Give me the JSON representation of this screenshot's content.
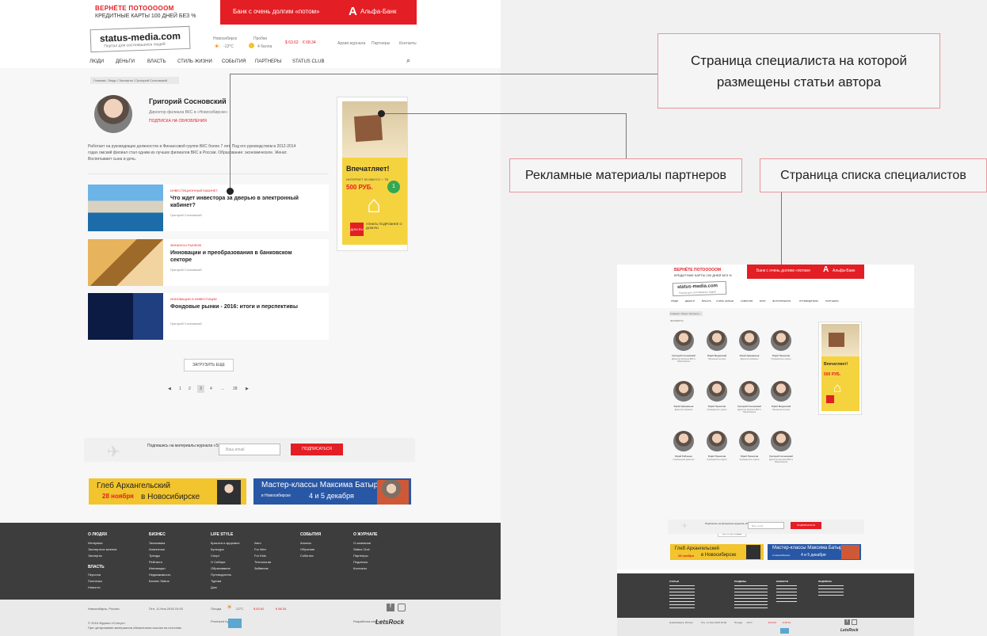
{
  "left": {
    "promo": {
      "line1": "ВЕРНЁТЕ ПОТОООООМ",
      "line2": "КРЕДИТНЫЕ КАРТЫ 100 ДНЕЙ БЕЗ %"
    },
    "bank": {
      "text": "Банк с очень долгим «потом»",
      "logo": "А",
      "name": "Альфа-Банк"
    },
    "brand": {
      "name": "status-media.com",
      "tagline": "Портал для состоявшихся людей"
    },
    "header_info": {
      "city": "Новосибирск",
      "temp": "-12°C",
      "traffic_label": "Пробки",
      "traffic": "4 балла",
      "usd": "$ 63.62",
      "eur": "€ 68.34",
      "links": [
        "Архив журнала",
        "Партнеры",
        "Контакты"
      ]
    },
    "nav": [
      "ЛЮДИ",
      "ДЕНЬГИ",
      "ВЛАСТЬ",
      "СТИЛЬ ЖИЗНИ",
      "СОБЫТИЯ",
      "ПАРТНЕРЫ",
      "STATUS CLUB"
    ],
    "breadcrumb": "Главная / Люди / Эксперты / Григорий Сосновский",
    "author": {
      "name": "Григорий Сосновский",
      "role": "Директор филиала ВКС в «Новосибирске»",
      "subscribe": "ПОДПИСКА НА ОБНОВЛЕНИЯ",
      "bio": "Работает на руководящих должностях в Финансовой группе ВКС более 7 лет. Под его руководством в 2012-2014 годах омский филиал стал одним из лучших филиалов ВКС в России. Образование: экономическое. Женат. Воспитывает сына и дочь."
    },
    "articles": [
      {
        "tag": "ИНВЕСТИЦИОННЫЙ КАБИНЕТ",
        "title": "Что ждет инвестора за дверью в электронный кабинет?",
        "author": "Григорий Сосновский"
      },
      {
        "tag": "ФИНАНСЫ РЫНКОВ",
        "title": "Инновации и преобразования в банковском секторе",
        "author": "Григорий Сосновский"
      },
      {
        "tag": "ИННОВАЦИИ И ИНВЕСТИЦИИ",
        "title": "Фондовые рынки - 2016: итоги и перспективы",
        "author": "Григорий Сосновский"
      }
    ],
    "ad": {
      "headline": "Впечатляет!",
      "offer": "ИНТЕРНЕТ 50 МБИТ/С + ТВ",
      "price": "500 РУБ.",
      "cta": "УЗНАТЬ ПОДРОБНЕЕ О ДОМ.RU",
      "brand": "ДОМ.RU"
    },
    "load_more": "ЗАГРУЗИТЬ ЕЩЕ",
    "pager": [
      "1",
      "2",
      "3",
      "4",
      "...",
      "28"
    ],
    "subscribe": {
      "label": "Подпишись на материалы журнала «Status»",
      "placeholder": "Ваш email",
      "button": "ПОДПИСАТЬСЯ"
    },
    "banners": [
      {
        "line1": "Глеб Архангельский",
        "line2": "28 ноября",
        "line3": "в Новосибирске"
      },
      {
        "line1": "Мастер-классы Максима Батырева",
        "line2": "в Новосибирске",
        "line3": "4 и 5 декабря"
      }
    ],
    "footer": {
      "col1_title": "О ЛЮДЯХ",
      "col1": [
        "Интервью",
        "Экспертное мнение",
        "Эксперты"
      ],
      "col1b_title": "ВЛАСТЬ",
      "col1b": [
        "Персона",
        "Политика",
        "Новости"
      ],
      "col2_title": "БИЗНЕС",
      "col2": [
        "Экономика",
        "Аналитика",
        "Тренды",
        "Рейтинги",
        "Инновации",
        "Недвижимость",
        "Бизнес Status"
      ],
      "col3_title": "LIFE STYLE",
      "col3": [
        "Красота и здоровье",
        "Культура",
        "Спорт",
        "О Сибири",
        "Образование",
        "Путеводитель",
        "Туризм",
        "Дом"
      ],
      "col4": [
        "Авто",
        "For Men",
        "For Kids",
        "Технологии",
        "Забвение"
      ],
      "col5_title": "СОБЫТИЯ",
      "col5": [
        "Анонсы",
        "Обучение",
        "События"
      ],
      "col6_title": "О ЖУРНАЛЕ",
      "col6": [
        "О компании",
        "Status Club",
        "Партнеры",
        "Подписка",
        "Контакты"
      ]
    },
    "bottom": {
      "city": "Новосибирск, Россия",
      "date": "Птн, 11 Ноя 2016 10:00",
      "weather": "Погода",
      "temp": "-12°C",
      "usd": "$ 63.62",
      "eur": "€ 68.34",
      "copyright": "© 2016 Журнал «Статус».",
      "copyright2": "При цитировании материалов обязательна ссылка на источник",
      "produced": "Produced by",
      "dev": "Разработка сайта",
      "dev_brand": "LetsRock"
    }
  },
  "annotations": [
    {
      "label": "Страница специалиста на которой размещены статьи автора"
    },
    {
      "label": "Рекламные материалы партнеров"
    },
    {
      "label": "Страница списка специалистов"
    }
  ],
  "right": {
    "promo": {
      "line1": "ВЕРНЁТЕ ПОТОООООМ",
      "line2": "КРЕДИТНЫЕ КАРТЫ 100 ДНЕЙ БЕЗ %"
    },
    "bank": {
      "text": "Банк с очень долгим «потом»",
      "logo": "А",
      "name": "Альфа-Банк"
    },
    "brand": {
      "name": "status-media.com",
      "tagline": "Портал для состоявшихся людей"
    },
    "nav": [
      "ЛЮДИ",
      "ДЕНЬГИ",
      "ВЛАСТЬ",
      "СТИЛЬ ЖИЗНИ",
      "СОБЫТИЯ",
      "БЛОГ",
      "ФОТОПРОЕКТЫ",
      "ПУТЕВОДИТЕЛЬ",
      "ПАРТНЕРЫ"
    ],
    "breadcrumb": "Главная / Люди / Эксперты",
    "section": "ЭКСПЕРТЫ",
    "specialists": [
      {
        "name": "Григорий Сосновский",
        "role": "Директор филиала ВКС в Новосибирске"
      },
      {
        "name": "Юрий Мединский",
        "role": "Начальник сектора"
      },
      {
        "name": "Юрий Афанасьев",
        "role": "Директор компании"
      },
      {
        "name": "Юрий Прокопов",
        "role": "Руководитель отдела"
      },
      {
        "name": "Юрий Афанасьев",
        "role": "Директор компании"
      },
      {
        "name": "Юрий Прокопов",
        "role": "Руководитель отдела"
      },
      {
        "name": "Григорий Сосновский",
        "role": "Директор филиала ВКС в Новосибирске"
      },
      {
        "name": "Юрий Мединский",
        "role": "Начальник сектора"
      },
      {
        "name": "Юрий Рябченко",
        "role": "Генеральный директор"
      },
      {
        "name": "Юрий Прокопов",
        "role": "Руководитель отдела"
      },
      {
        "name": "Юрий Прокопов",
        "role": "Руководитель отдела"
      },
      {
        "name": "Григорий Сосновский",
        "role": "Директор филиала ВКС в Новосибирске"
      }
    ],
    "ad": {
      "headline": "Впечатляет!",
      "price": "500 РУБ."
    },
    "load_more": "ЗАГРУЗИТЬ ЕЩЕ",
    "pager": [
      "1",
      "2",
      "3",
      "4",
      "...",
      "28"
    ],
    "subscribe": {
      "label": "Подпишись на материалы журнала «Status»",
      "placeholder": "Ваш email",
      "button": "ПОДПИСАТЬСЯ"
    },
    "banners": [
      {
        "line1": "Глеб Архангельский",
        "line2": "28 ноября",
        "line3": "в Новосибирске"
      },
      {
        "line1": "Мастер-классы Максима Батырева",
        "line2": "в Новосибирске",
        "line3": "4 и 5 декабря"
      }
    ],
    "footer": {
      "col1_title": "СТАТЬИ",
      "col2_title": "РАЗДЕЛЫ",
      "col3_title": "НОВОСТИ",
      "col4_title": "ПОДПИСКА"
    },
    "bottom": {
      "city": "Новосибирск, Россия",
      "date": "Птн, 11 Ноя 2016 10:00",
      "weather": "Погода",
      "temp": "-12°C",
      "usd": "$ 63.62",
      "eur": "€ 68.34",
      "dev_brand": "LetsRock"
    }
  },
  "colors": {
    "accent": "#e31e24",
    "footer": "#3d3d3d",
    "yellow": "#f5d33f",
    "blue": "#2857a5"
  }
}
